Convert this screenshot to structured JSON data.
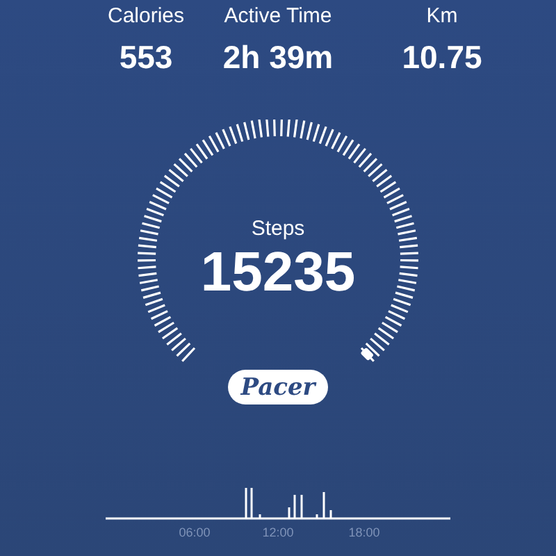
{
  "stats": [
    {
      "label": "Calories",
      "value": "553"
    },
    {
      "label": "Active Time",
      "value": "2h 39m"
    },
    {
      "label": "Km",
      "value": "10.75"
    }
  ],
  "gauge": {
    "label": "Steps",
    "value": "15235"
  },
  "brand_button": {
    "label": "Pacer"
  },
  "activity_chart": {
    "time_labels": [
      "06:00",
      "12:00",
      "18:00"
    ]
  }
}
